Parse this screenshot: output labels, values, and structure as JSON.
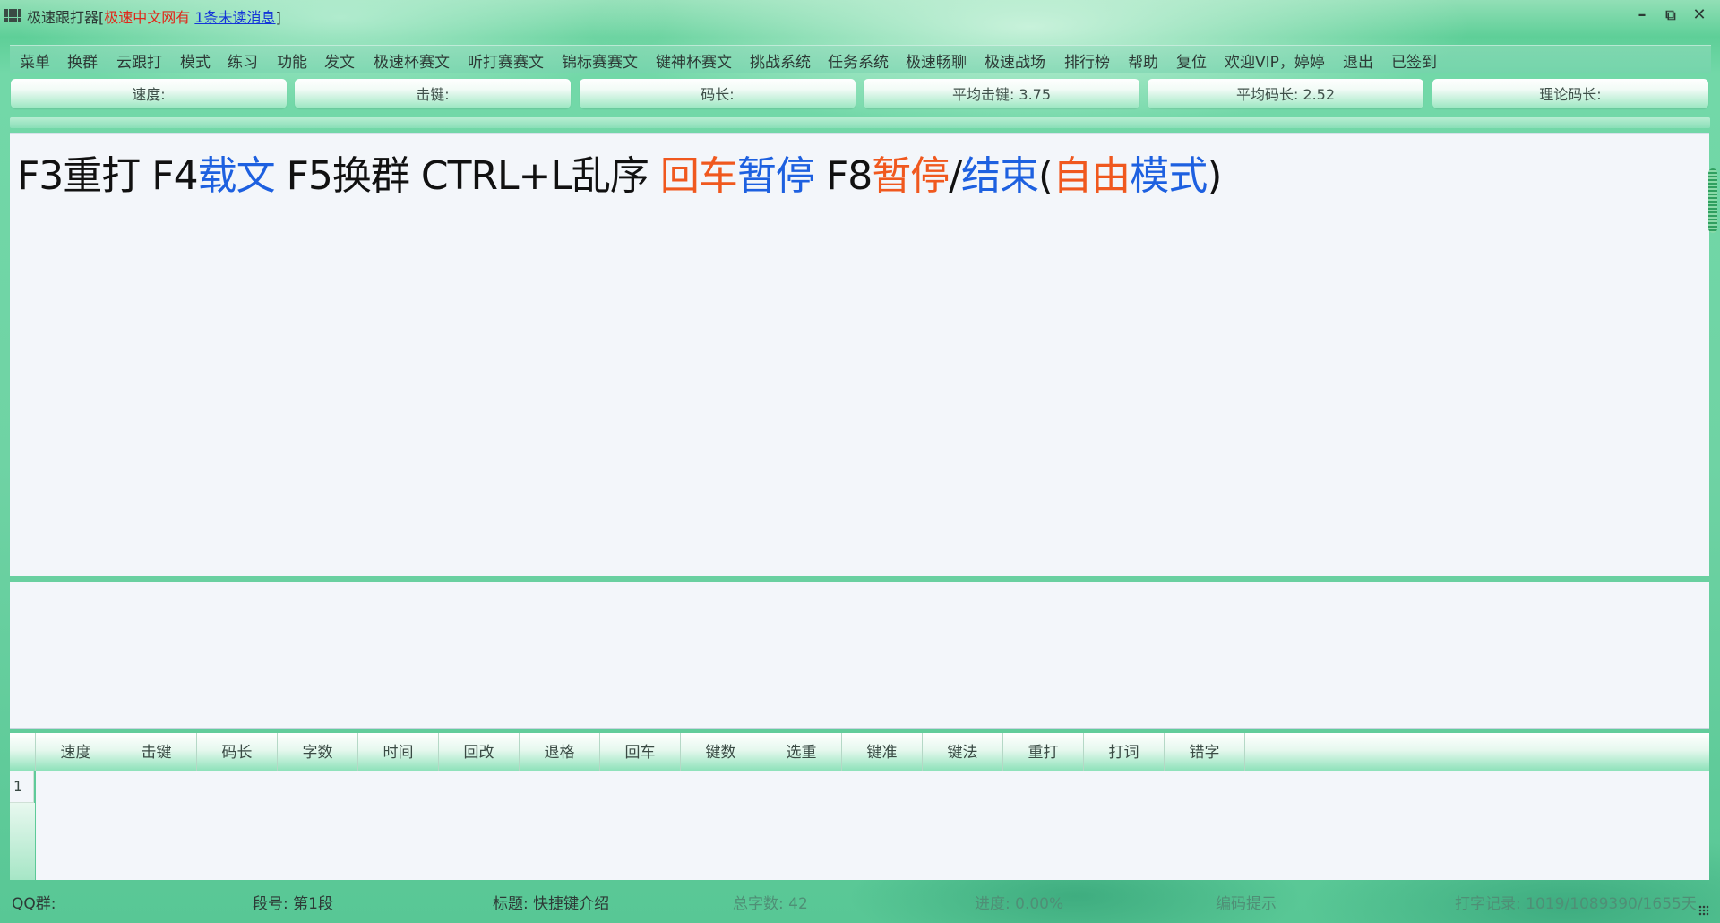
{
  "titlebar": {
    "app_name": "极速跟打器",
    "bracket_open": "[",
    "site_name": "极速中文网有",
    "message_link": "1条未读消息",
    "bracket_close": "]",
    "buttons": [
      "minimize-icon",
      "restore-icon",
      "close-icon"
    ]
  },
  "menu": [
    "菜单",
    "换群",
    "云跟打",
    "模式",
    "练习",
    "功能",
    "发文",
    "极速杯赛文",
    "听打赛赛文",
    "锦标赛赛文",
    "键神杯赛文",
    "挑战系统",
    "任务系统",
    "极速畅聊",
    "极速战场",
    "排行榜",
    "帮助",
    "复位",
    "欢迎VIP，婷婷",
    "退出",
    "已签到"
  ],
  "stats": [
    "速度:",
    "击键:",
    "码长:",
    "平均击键: 3.75",
    "平均码长: 2.52",
    "理论码长:"
  ],
  "text": {
    "seg1": "F3重打 F4",
    "seg2": "载文",
    "seg3": " F5换群 CTRL+L乱序 ",
    "seg4": "回车",
    "seg5": "暂停",
    "seg6": " F8",
    "seg7": "暂停",
    "seg8": "/",
    "seg9": "结束",
    "seg10": "(",
    "seg11": "自由",
    "seg12": "模式",
    "seg13": ")"
  },
  "table": {
    "columns": [
      "速度",
      "击键",
      "码长",
      "字数",
      "时间",
      "回改",
      "退格",
      "回车",
      "键数",
      "选重",
      "键准",
      "键法",
      "重打",
      "打词",
      "错字"
    ],
    "rows": [
      "1"
    ]
  },
  "status": {
    "qq": "QQ群:",
    "segment": "段号: 第1段",
    "title": "标题: 快捷键介绍",
    "total": "总字数: 42",
    "progress": "进度: 0.00%",
    "hint": "编码提示",
    "record": "打字记录: 1019/1089390/1655天"
  },
  "colors": {
    "orange": "#f0581e",
    "blue": "#1d60e0",
    "title_red": "#e0281a",
    "link_blue": "#1436d8"
  }
}
